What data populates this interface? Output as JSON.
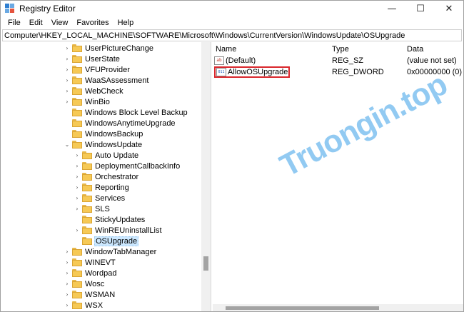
{
  "window": {
    "title": "Registry Editor"
  },
  "controls": {
    "minimize": "—",
    "maximize": "☐",
    "close": "✕"
  },
  "menu": [
    "File",
    "Edit",
    "View",
    "Favorites",
    "Help"
  ],
  "address": "Computer\\HKEY_LOCAL_MACHINE\\SOFTWARE\\Microsoft\\Windows\\CurrentVersion\\WindowsUpdate\\OSUpgrade",
  "tree": [
    {
      "label": "UserPictureChange",
      "chevron": "›",
      "depth": 0,
      "selected": false
    },
    {
      "label": "UserState",
      "chevron": "›",
      "depth": 0,
      "selected": false
    },
    {
      "label": "VFUProvider",
      "chevron": "›",
      "depth": 0,
      "selected": false
    },
    {
      "label": "WaaSAssessment",
      "chevron": "›",
      "depth": 0,
      "selected": false
    },
    {
      "label": "WebCheck",
      "chevron": "›",
      "depth": 0,
      "selected": false
    },
    {
      "label": "WinBio",
      "chevron": "›",
      "depth": 0,
      "selected": false
    },
    {
      "label": "Windows Block Level Backup",
      "chevron": "",
      "depth": 0,
      "selected": false
    },
    {
      "label": "WindowsAnytimeUpgrade",
      "chevron": "",
      "depth": 0,
      "selected": false
    },
    {
      "label": "WindowsBackup",
      "chevron": "",
      "depth": 0,
      "selected": false
    },
    {
      "label": "WindowsUpdate",
      "chevron": "⌄",
      "depth": 0,
      "selected": false
    },
    {
      "label": "Auto Update",
      "chevron": "›",
      "depth": 1,
      "selected": false
    },
    {
      "label": "DeploymentCallbackInfo",
      "chevron": "›",
      "depth": 1,
      "selected": false
    },
    {
      "label": "Orchestrator",
      "chevron": "›",
      "depth": 1,
      "selected": false
    },
    {
      "label": "Reporting",
      "chevron": "›",
      "depth": 1,
      "selected": false
    },
    {
      "label": "Services",
      "chevron": "›",
      "depth": 1,
      "selected": false
    },
    {
      "label": "SLS",
      "chevron": "›",
      "depth": 1,
      "selected": false
    },
    {
      "label": "StickyUpdates",
      "chevron": "",
      "depth": 1,
      "selected": false
    },
    {
      "label": "WinREUninstallList",
      "chevron": "›",
      "depth": 1,
      "selected": false
    },
    {
      "label": "OSUpgrade",
      "chevron": "",
      "depth": 1,
      "selected": true
    },
    {
      "label": "WindowTabManager",
      "chevron": "›",
      "depth": 0,
      "selected": false
    },
    {
      "label": "WINEVT",
      "chevron": "›",
      "depth": 0,
      "selected": false
    },
    {
      "label": "Wordpad",
      "chevron": "›",
      "depth": 0,
      "selected": false
    },
    {
      "label": "Wosc",
      "chevron": "›",
      "depth": 0,
      "selected": false
    },
    {
      "label": "WSMAN",
      "chevron": "›",
      "depth": 0,
      "selected": false
    },
    {
      "label": "WSX",
      "chevron": "›",
      "depth": 0,
      "selected": false
    }
  ],
  "list": {
    "headers": {
      "name": "Name",
      "type": "Type",
      "data": "Data"
    },
    "rows": [
      {
        "name": "(Default)",
        "type": "REG_SZ",
        "data": "(value not set)",
        "icon": "ab",
        "highlighted": false
      },
      {
        "name": "AllowOSUpgrade",
        "type": "REG_DWORD",
        "data": "0x00000000 (0)",
        "icon": "011",
        "highlighted": true
      }
    ]
  },
  "watermark": "Truongin.top",
  "colors": {
    "folder": "#f6c955",
    "highlight": "#d9262c",
    "selection": "#cce8ff",
    "watermark": "#3aa0e8"
  }
}
